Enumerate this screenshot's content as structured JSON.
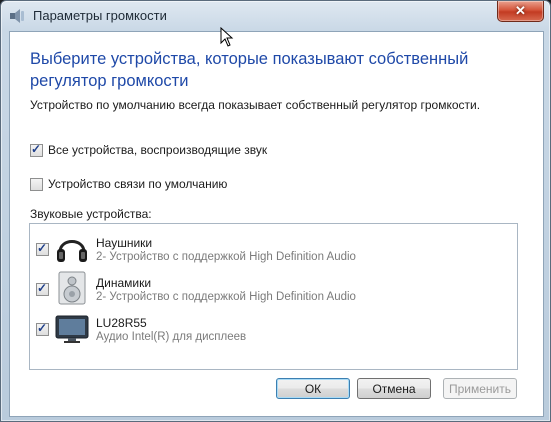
{
  "window": {
    "title": "Параметры громкости",
    "close_glyph": "✕"
  },
  "dialog": {
    "heading_line1": "Выберите устройства, которые показывают собственный",
    "heading_line2": "регулятор громкости",
    "description": "Устройство по умолчанию всегда показывает собственный регулятор громкости.",
    "options": [
      {
        "label": "Все устройства, воспроизводящие звук",
        "checked": true
      },
      {
        "label": "Устройство связи по умолчанию",
        "checked": false
      }
    ],
    "section_label": "Звуковые устройства:",
    "devices": [
      {
        "name": "Наушники",
        "desc": "2- Устройство с поддержкой High Definition Audio",
        "checked": true,
        "icon": "headphones-icon"
      },
      {
        "name": "Динамики",
        "desc": "2- Устройство с поддержкой High Definition Audio",
        "checked": true,
        "icon": "speaker-icon"
      },
      {
        "name": "LU28R55",
        "desc": "Аудио Intel(R) для дисплеев",
        "checked": true,
        "icon": "monitor-icon"
      }
    ]
  },
  "buttons": {
    "ok": "ОК",
    "cancel": "Отмена",
    "apply": "Применить"
  },
  "colors": {
    "heading": "#1f49a8",
    "close": "#c33b22"
  }
}
